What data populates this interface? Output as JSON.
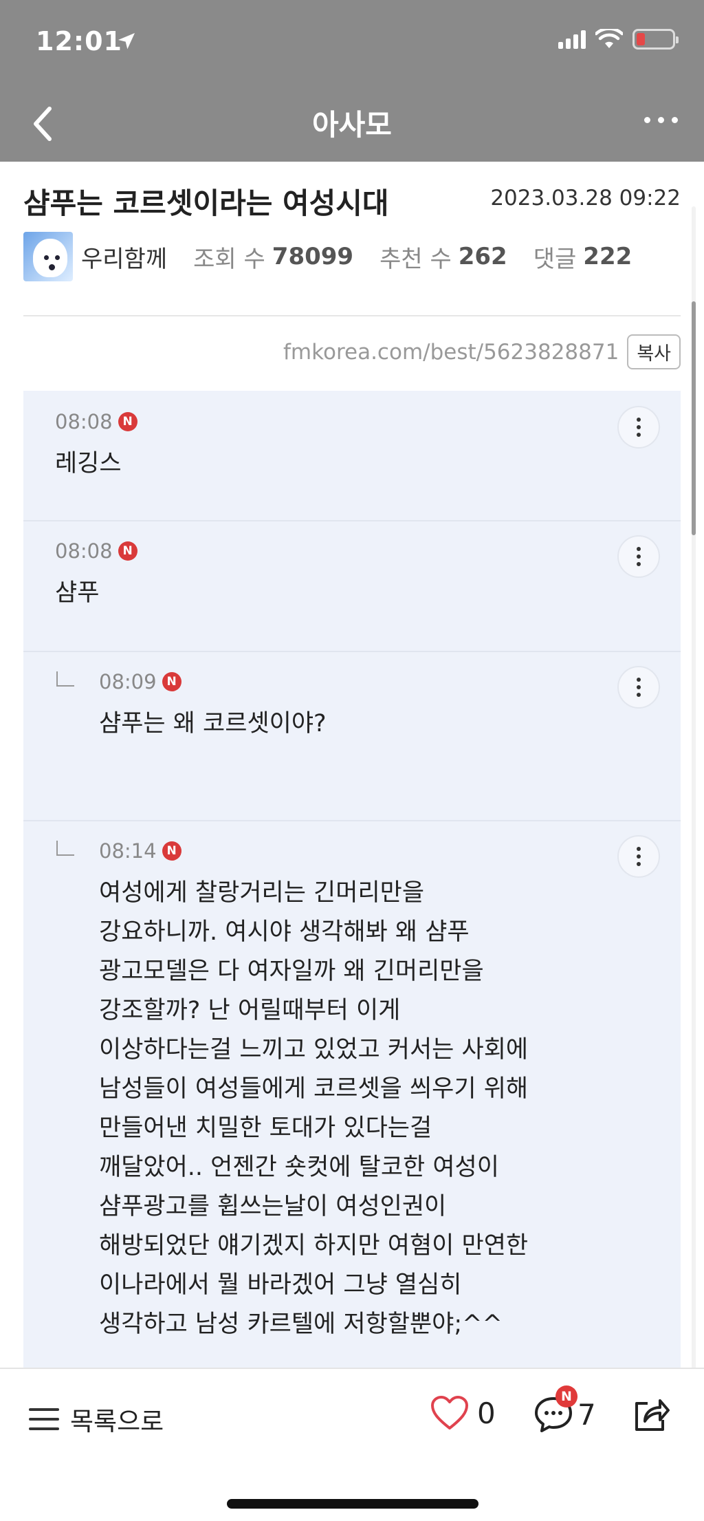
{
  "status_bar": {
    "time": "12:01"
  },
  "header": {
    "title": "아사모"
  },
  "post": {
    "title": "샴푸는 코르셋이라는 여성시대",
    "date": "2023.03.28 09:22",
    "author": "우리함께",
    "views_label": "조회 수",
    "views": "78099",
    "recommend_label": "추천 수",
    "recommends": "262",
    "comments_label": "댓글",
    "comments": "222",
    "source_url": "fmkorea.com/best/5623828871",
    "copy_label": "복사"
  },
  "comments": [
    {
      "time": "08:08",
      "badge": "N",
      "text": "레깅스",
      "reply": false
    },
    {
      "time": "08:08",
      "badge": "N",
      "text": "샴푸",
      "reply": false
    },
    {
      "time": "08:09",
      "badge": "N",
      "text": "샴푸는 왜 코르셋이야?",
      "reply": true
    },
    {
      "time": "08:14",
      "badge": "N",
      "text": "여성에게 찰랑거리는 긴머리만을\n강요하니까. 여시야 생각해봐 왜 샴푸\n광고모델은 다 여자일까 왜 긴머리만을\n강조할까? 난 어릴때부터 이게\n이상하다는걸 느끼고 있었고 커서는 사회에\n남성들이 여성들에게 코르셋을 씌우기 위해\n만들어낸 치밀한 토대가 있다는걸\n깨달았어.. 언젠간 숏컷에 탈코한 여성이\n샴푸광고를 휩쓰는날이 여성인권이\n해방되었단 얘기겠지 하지만 여혐이 만연한\n이나라에서 뭘 바라겠어 그냥 열심히\n생각하고 남성 카르텔에 저항할뿐야;^^",
      "reply": true
    }
  ],
  "bottom_bar": {
    "list_label": "목록으로",
    "likes": "0",
    "comment_count": "7",
    "comment_badge": "N"
  },
  "colors": {
    "header_bg": "#8a8a8a",
    "comment_bg": "#eef2fa",
    "new_badge": "#d93a3a"
  },
  "icons": [
    "back-icon",
    "more-icon",
    "location-arrow-icon",
    "signal-icon",
    "wifi-icon",
    "battery-icon",
    "kebab-icon",
    "reply-icon",
    "hamburger-icon",
    "heart-icon",
    "comment-icon",
    "share-icon"
  ]
}
